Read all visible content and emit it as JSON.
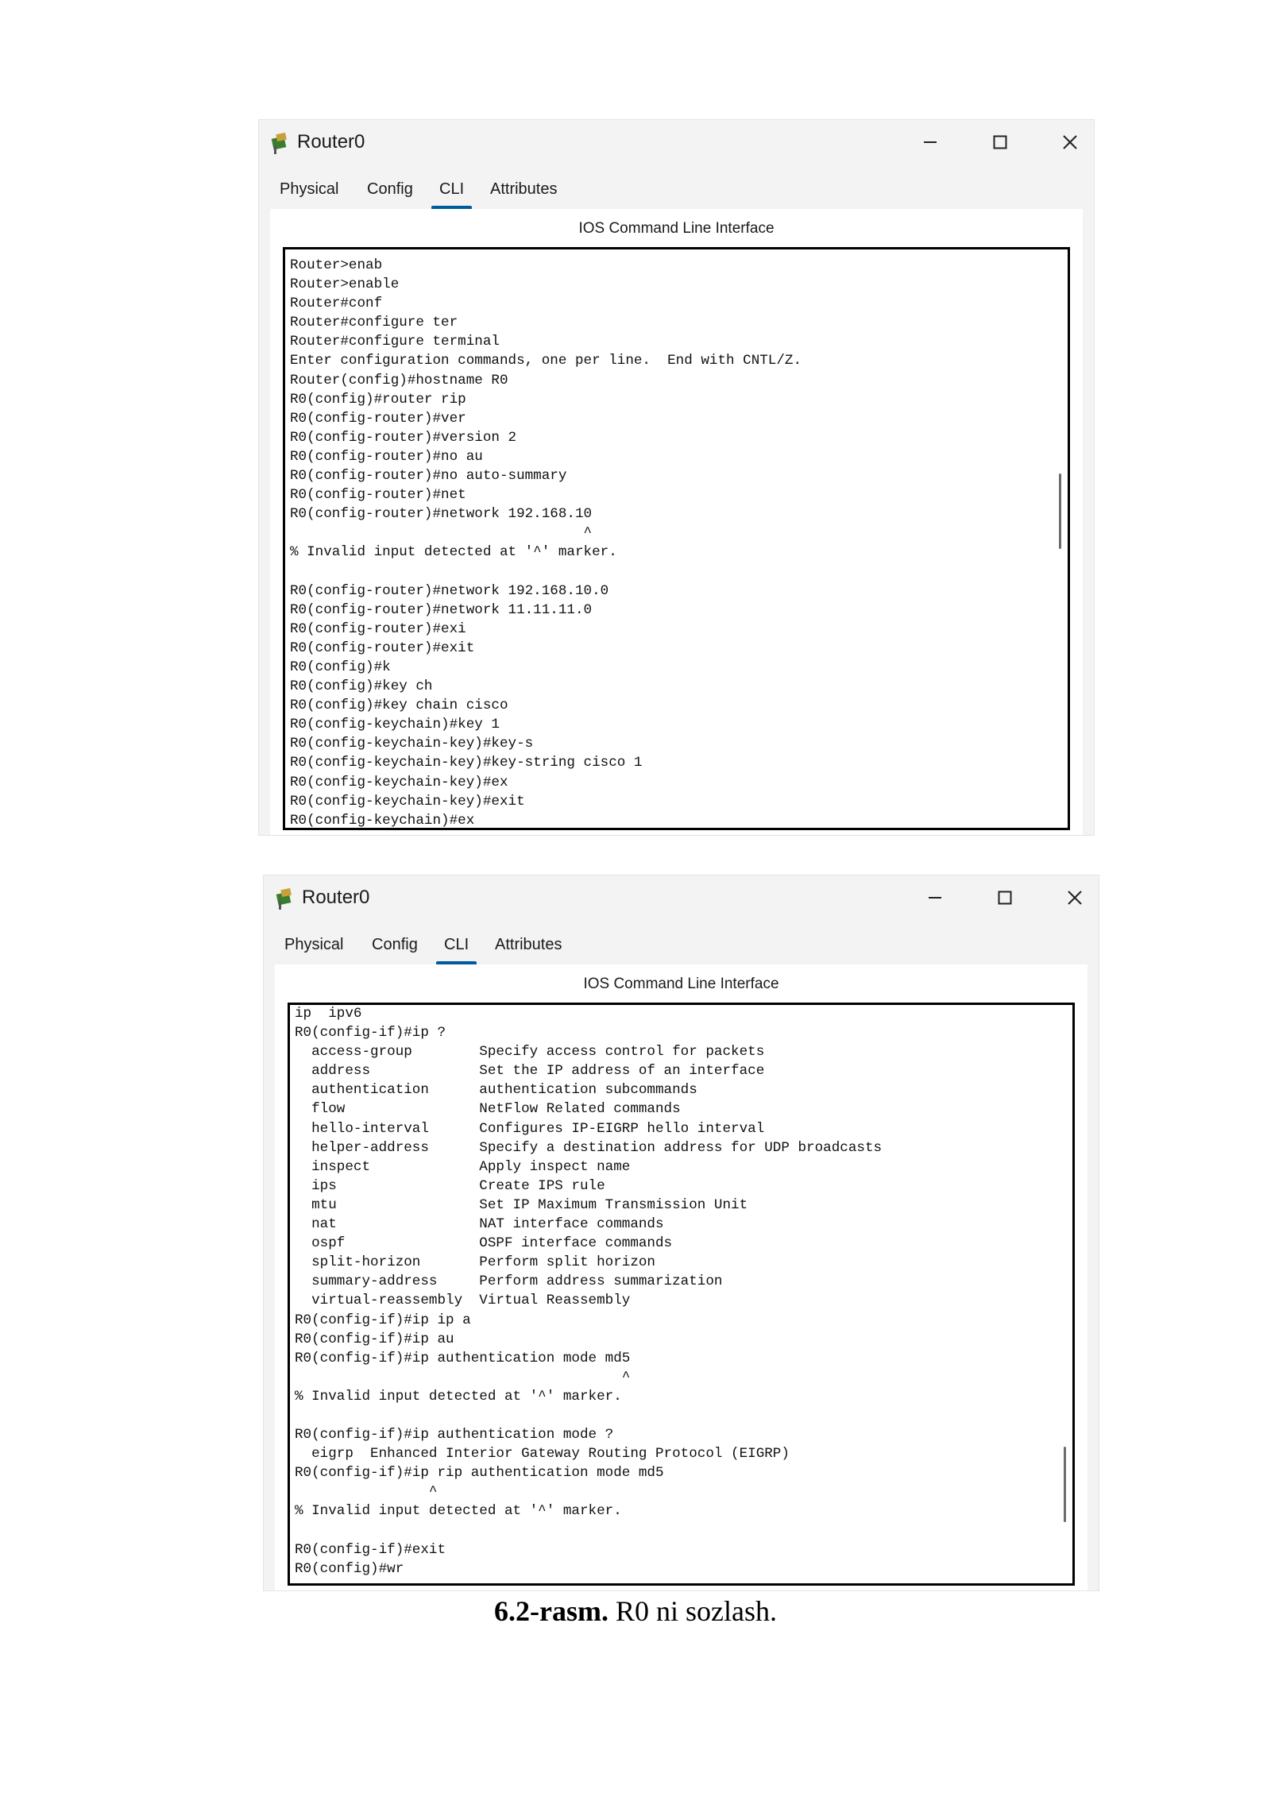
{
  "windows": [
    {
      "title": "Router0",
      "tabs": [
        "Physical",
        "Config",
        "CLI",
        "Attributes"
      ],
      "active_tab": "CLI",
      "panel_title": "IOS Command Line Interface",
      "terminal": "Router>enab\nRouter>enable\nRouter#conf\nRouter#configure ter\nRouter#configure terminal\nEnter configuration commands, one per line.  End with CNTL/Z.\nRouter(config)#hostname R0\nR0(config)#router rip\nR0(config-router)#ver\nR0(config-router)#version 2\nR0(config-router)#no au\nR0(config-router)#no auto-summary\nR0(config-router)#net\nR0(config-router)#network 192.168.10\n                                   ^\n% Invalid input detected at '^' marker.\n\nR0(config-router)#network 192.168.10.0\nR0(config-router)#network 11.11.11.0\nR0(config-router)#exi\nR0(config-router)#exit\nR0(config)#k\nR0(config)#key ch\nR0(config)#key chain cisco\nR0(config-keychain)#key 1\nR0(config-keychain-key)#key-s\nR0(config-keychain-key)#key-string cisco 1\nR0(config-keychain-key)#ex\nR0(config-keychain-key)#exit\nR0(config-keychain)#ex"
    },
    {
      "title": "Router0",
      "tabs": [
        "Physical",
        "Config",
        "CLI",
        "Attributes"
      ],
      "active_tab": "CLI",
      "panel_title": "IOS Command Line Interface",
      "terminal": "ip  ipv6\nR0(config-if)#ip ?\n  access-group        Specify access control for packets\n  address             Set the IP address of an interface\n  authentication      authentication subcommands\n  flow                NetFlow Related commands\n  hello-interval      Configures IP-EIGRP hello interval\n  helper-address      Specify a destination address for UDP broadcasts\n  inspect             Apply inspect name\n  ips                 Create IPS rule\n  mtu                 Set IP Maximum Transmission Unit\n  nat                 NAT interface commands\n  ospf                OSPF interface commands\n  split-horizon       Perform split horizon\n  summary-address     Perform address summarization\n  virtual-reassembly  Virtual Reassembly\nR0(config-if)#ip ip a\nR0(config-if)#ip au\nR0(config-if)#ip authentication mode md5\n                                       ^\n% Invalid input detected at '^' marker.\n\nR0(config-if)#ip authentication mode ?\n  eigrp  Enhanced Interior Gateway Routing Protocol (EIGRP)\nR0(config-if)#ip rip authentication mode md5\n                ^\n% Invalid input detected at '^' marker.\n\nR0(config-if)#exit\nR0(config)#wr"
    }
  ],
  "caption": {
    "label": "6.2-rasm.",
    "text": " R0 ni sozlash."
  }
}
